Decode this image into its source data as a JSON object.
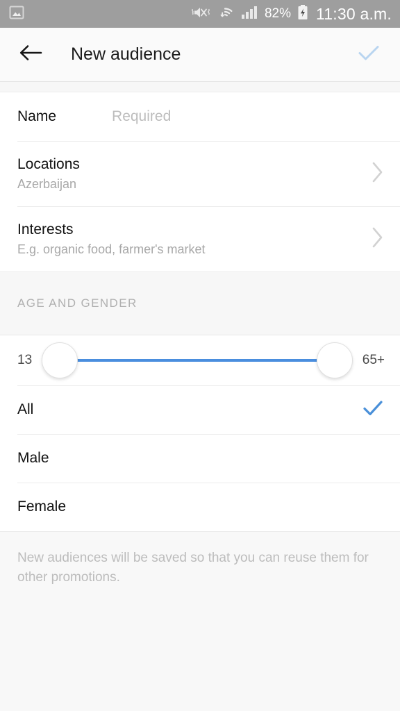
{
  "statusbar": {
    "notification_icon": "photo-icon",
    "vibrate_icon": "vibrate-mute-icon",
    "wifi_icon": "wifi-icon",
    "signal_icon": "cellular-signal-icon",
    "battery_percent": "82%",
    "battery_icon": "battery-charging-icon",
    "time": "11:30 a.m.",
    "background": "#9e9e9e"
  },
  "appbar": {
    "back_icon": "back-arrow-icon",
    "title": "New audience",
    "confirm_icon": "check-icon",
    "confirm_color": "#b9d5f0"
  },
  "form": {
    "name": {
      "label": "Name",
      "placeholder": "Required"
    },
    "locations": {
      "label": "Locations",
      "value": "Azerbaijan",
      "chevron_icon": "chevron-right-icon"
    },
    "interests": {
      "label": "Interests",
      "value": "E.g. organic food, farmer's market",
      "chevron_icon": "chevron-right-icon"
    }
  },
  "age_gender": {
    "section_title": "AGE AND GENDER",
    "slider": {
      "min_label": "13",
      "max_label": "65+",
      "track_color": "#4a8ede",
      "low_value": 13,
      "high_value": 65
    },
    "options": [
      {
        "label": "All",
        "selected": true
      },
      {
        "label": "Male",
        "selected": false
      },
      {
        "label": "Female",
        "selected": false
      }
    ],
    "selected_check_icon": "check-icon",
    "selected_check_color": "#4a90d9"
  },
  "footer": {
    "text": "New audiences will be saved so that you can reuse them for other promotions."
  }
}
